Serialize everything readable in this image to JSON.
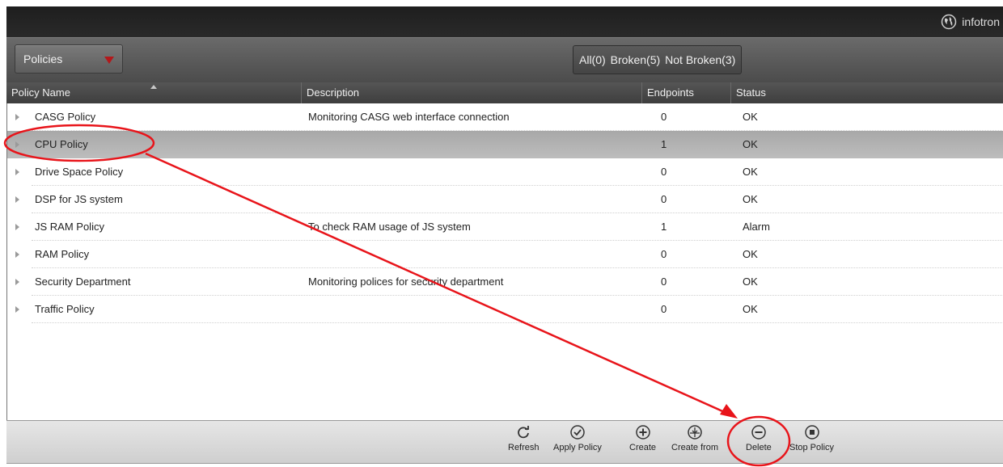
{
  "user": {
    "name": "infotron",
    "icon": "globe-icon"
  },
  "filter": {
    "dropdown_value": "Policies",
    "segments": [
      "All(0)",
      "Broken(5)",
      "Not Broken(3)"
    ]
  },
  "table": {
    "columns": [
      "Policy Name",
      "Description",
      "Endpoints",
      "Status"
    ],
    "rows": [
      {
        "name": "CASG Policy",
        "description": "Monitoring CASG web interface connection",
        "endpoints": "0",
        "status": "OK"
      },
      {
        "name": "CPU Policy",
        "description": "",
        "endpoints": "1",
        "status": "OK",
        "selected": true
      },
      {
        "name": "Drive Space Policy",
        "description": "",
        "endpoints": "0",
        "status": "OK"
      },
      {
        "name": "DSP for JS system",
        "description": "",
        "endpoints": "0",
        "status": "OK"
      },
      {
        "name": "JS RAM Policy",
        "description": "To check RAM usage of JS system",
        "endpoints": "1",
        "status": "Alarm"
      },
      {
        "name": "RAM Policy",
        "description": "",
        "endpoints": "0",
        "status": "OK"
      },
      {
        "name": "Security Department",
        "description": "Monitoring polices for security department",
        "endpoints": "0",
        "status": "OK"
      },
      {
        "name": "Traffic Policy",
        "description": "",
        "endpoints": "0",
        "status": "OK"
      }
    ]
  },
  "toolbar": {
    "buttons": [
      {
        "label": "Refresh",
        "icon": "refresh-icon"
      },
      {
        "label": "Apply Policy",
        "icon": "check-circle-icon"
      },
      {
        "label": "Create",
        "icon": "plus-circle-icon"
      },
      {
        "label": "Create from",
        "icon": "copy-circle-icon"
      },
      {
        "label": "Delete",
        "icon": "minus-circle-icon"
      },
      {
        "label": "Stop Policy",
        "icon": "stop-circle-icon"
      }
    ]
  },
  "annotation": {
    "color": "#e8141a"
  }
}
